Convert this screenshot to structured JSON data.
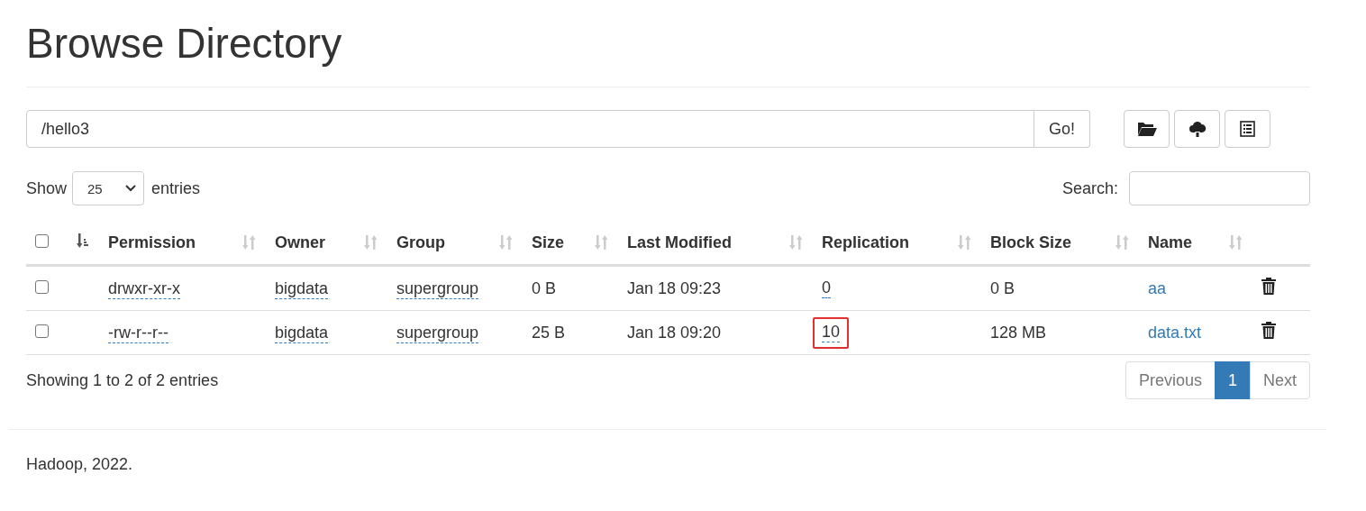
{
  "title": "Browse Directory",
  "path": {
    "value": "/hello3",
    "go": "Go!"
  },
  "tool_buttons": [
    {
      "kind": "folder"
    },
    {
      "kind": "upload"
    },
    {
      "kind": "list"
    }
  ],
  "length": {
    "label_before": "Show",
    "value": "25",
    "label_after": "entries"
  },
  "search": {
    "label": "Search:"
  },
  "table": {
    "select_all_checked": false,
    "columns": [
      {
        "label": "Permission"
      },
      {
        "label": "Owner"
      },
      {
        "label": "Group"
      },
      {
        "label": "Size"
      },
      {
        "label": "Last Modified"
      },
      {
        "label": "Replication"
      },
      {
        "label": "Block Size"
      },
      {
        "label": "Name"
      }
    ],
    "rows": [
      {
        "checked": false,
        "permission": "drwxr-xr-x",
        "owner": "bigdata",
        "group": "supergroup",
        "size": "0 B",
        "modified": "Jan 18 09:23",
        "replication": "0",
        "replication_highlighted": false,
        "block_size": "0 B",
        "name": "aa"
      },
      {
        "checked": false,
        "permission": "-rw-r--r--",
        "owner": "bigdata",
        "group": "supergroup",
        "size": "25 B",
        "modified": "Jan 18 09:20",
        "replication": "10",
        "replication_highlighted": true,
        "block_size": "128 MB",
        "name": "data.txt"
      }
    ]
  },
  "info": "Showing 1 to 2 of 2 entries",
  "pagination": [
    {
      "label": "Previous",
      "selected": false
    },
    {
      "label": "1",
      "selected": true
    },
    {
      "label": "Next",
      "selected": false
    }
  ],
  "footer": "Hadoop, 2022."
}
